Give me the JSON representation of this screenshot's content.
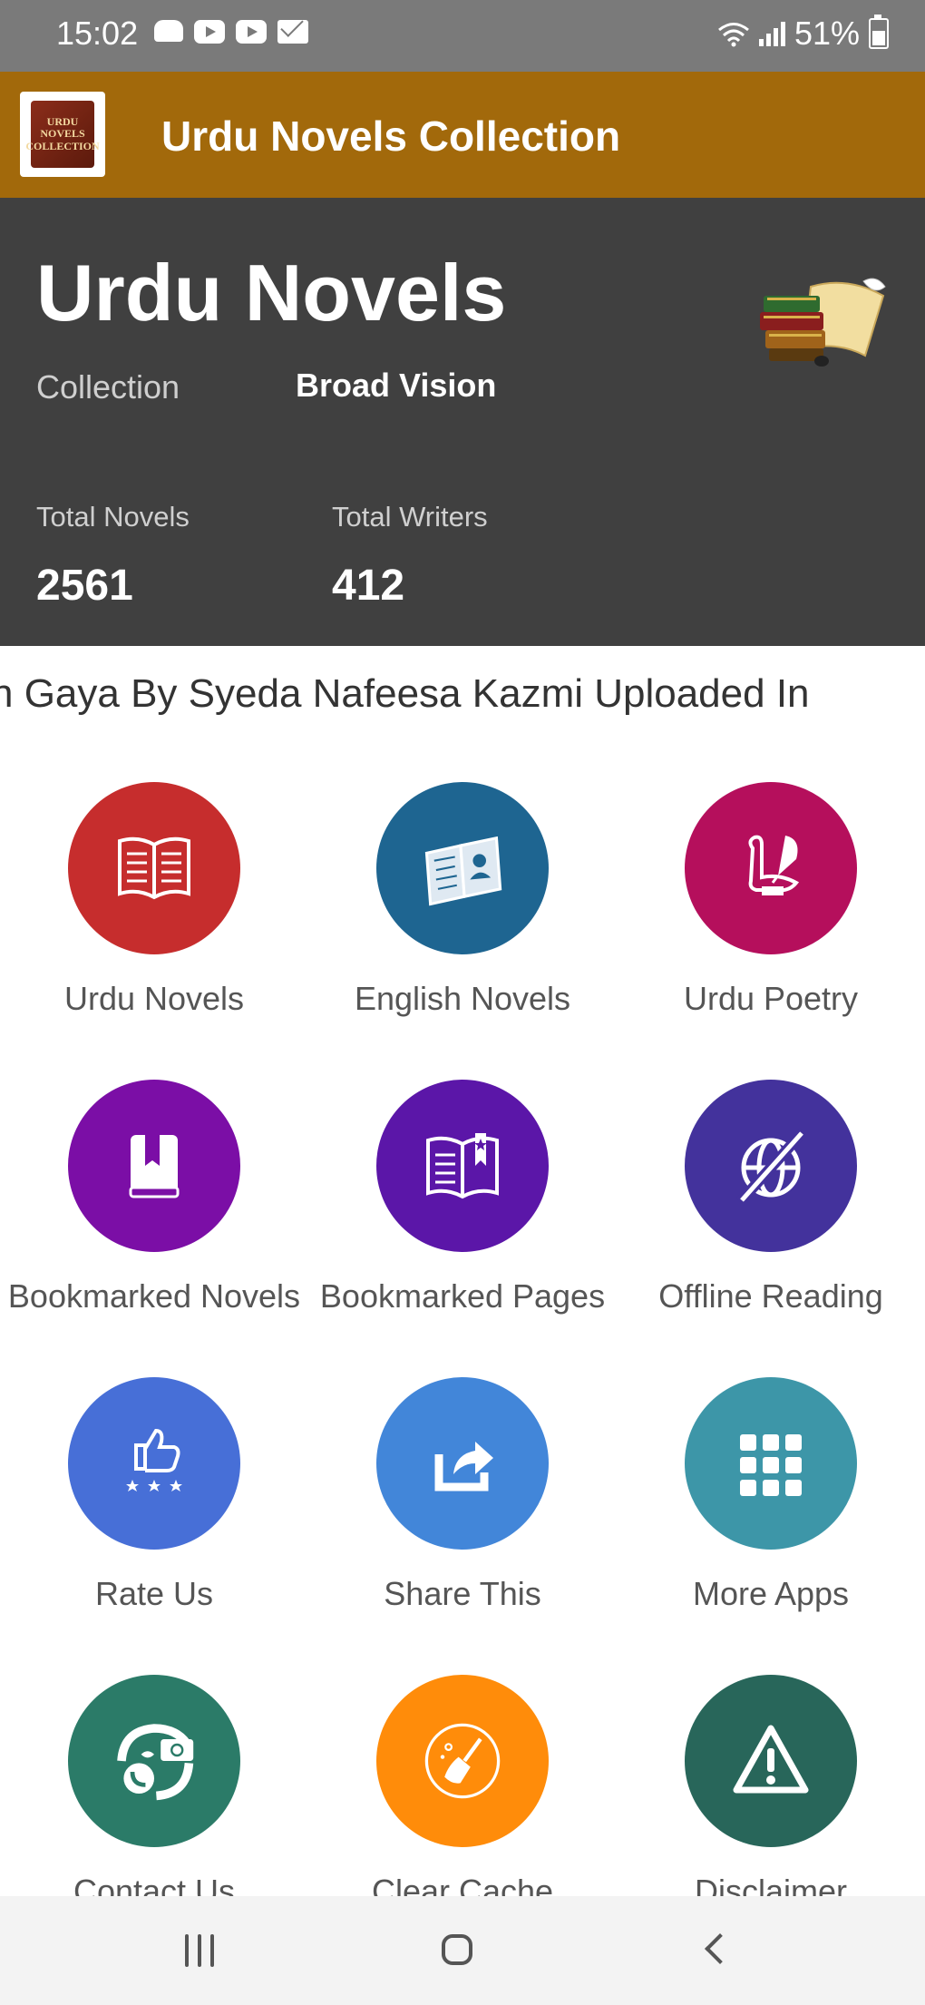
{
  "status_bar": {
    "time": "15:02",
    "battery": "51%",
    "icons_left": [
      "car-icon",
      "youtube-icon",
      "youtube-icon",
      "mail-icon"
    ],
    "icons_right": [
      "wifi-icon",
      "signal-icon",
      "battery-icon"
    ]
  },
  "app_bar": {
    "title": "Urdu Novels Collection",
    "logo_text": [
      "URDU",
      "NOVELS",
      "COLLECTION"
    ]
  },
  "header": {
    "title": "Urdu Novels",
    "collection_label": "Collection",
    "brand": "Broad Vision",
    "total_novels_label": "Total Novels",
    "total_novels": "2561",
    "total_writers_label": "Total Writers",
    "total_writers": "412"
  },
  "ticker": {
    "text": "n Gaya By Syeda Nafeesa Kazmi Uploaded In"
  },
  "menu": {
    "items": [
      {
        "label": "Urdu Novels",
        "color": "#c62d2d",
        "icon": "open-book-icon"
      },
      {
        "label": "English Novels",
        "color": "#1e6591",
        "icon": "illustrated-book-icon"
      },
      {
        "label": "Urdu Poetry",
        "color": "#b50f5c",
        "icon": "quill-scroll-icon"
      },
      {
        "label": "Bookmarked Novels",
        "color": "#7b0ea6",
        "icon": "bookmarked-book-icon"
      },
      {
        "label": "Bookmarked Pages",
        "color": "#5b16a8",
        "icon": "book-star-icon"
      },
      {
        "label": "Offline Reading",
        "color": "#43329c",
        "icon": "no-globe-icon"
      },
      {
        "label": "Rate Us",
        "color": "#476fd7",
        "icon": "thumbs-up-stars-icon"
      },
      {
        "label": "Share This",
        "color": "#4286d9",
        "icon": "share-icon"
      },
      {
        "label": "More Apps",
        "color": "#3d96a8",
        "icon": "grid-icon"
      },
      {
        "label": "Contact Us",
        "color": "#2b7b68",
        "icon": "contact-icon"
      },
      {
        "label": "Clear Cache",
        "color": "#ff8c0a",
        "icon": "broom-icon"
      },
      {
        "label": "Disclaimer",
        "color": "#28665a",
        "icon": "warning-icon"
      }
    ]
  },
  "nav_bar": {
    "buttons": [
      "recent-apps-icon",
      "home-icon",
      "back-icon"
    ]
  }
}
